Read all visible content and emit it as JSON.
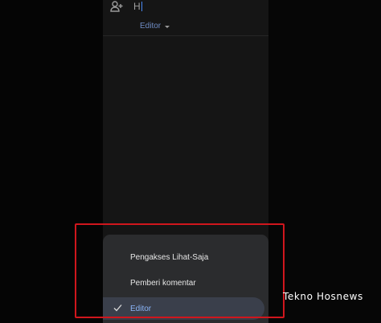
{
  "share": {
    "name_input_value": "H",
    "selected_role": "Editor"
  },
  "menu": {
    "items": [
      {
        "label": "Pengakses Lihat-Saja",
        "selected": false
      },
      {
        "label": "Pemberi komentar",
        "selected": false
      },
      {
        "label": "Editor",
        "selected": true
      }
    ]
  },
  "watermark": "Tekno Hosnews",
  "colors": {
    "accent": "#8ab4f8",
    "highlight": "#d0161d",
    "sheet": "#2b2c2e"
  },
  "icons": {
    "add_person": "person-add-icon",
    "check": "check-icon",
    "dropdown": "chevron-down-icon"
  }
}
